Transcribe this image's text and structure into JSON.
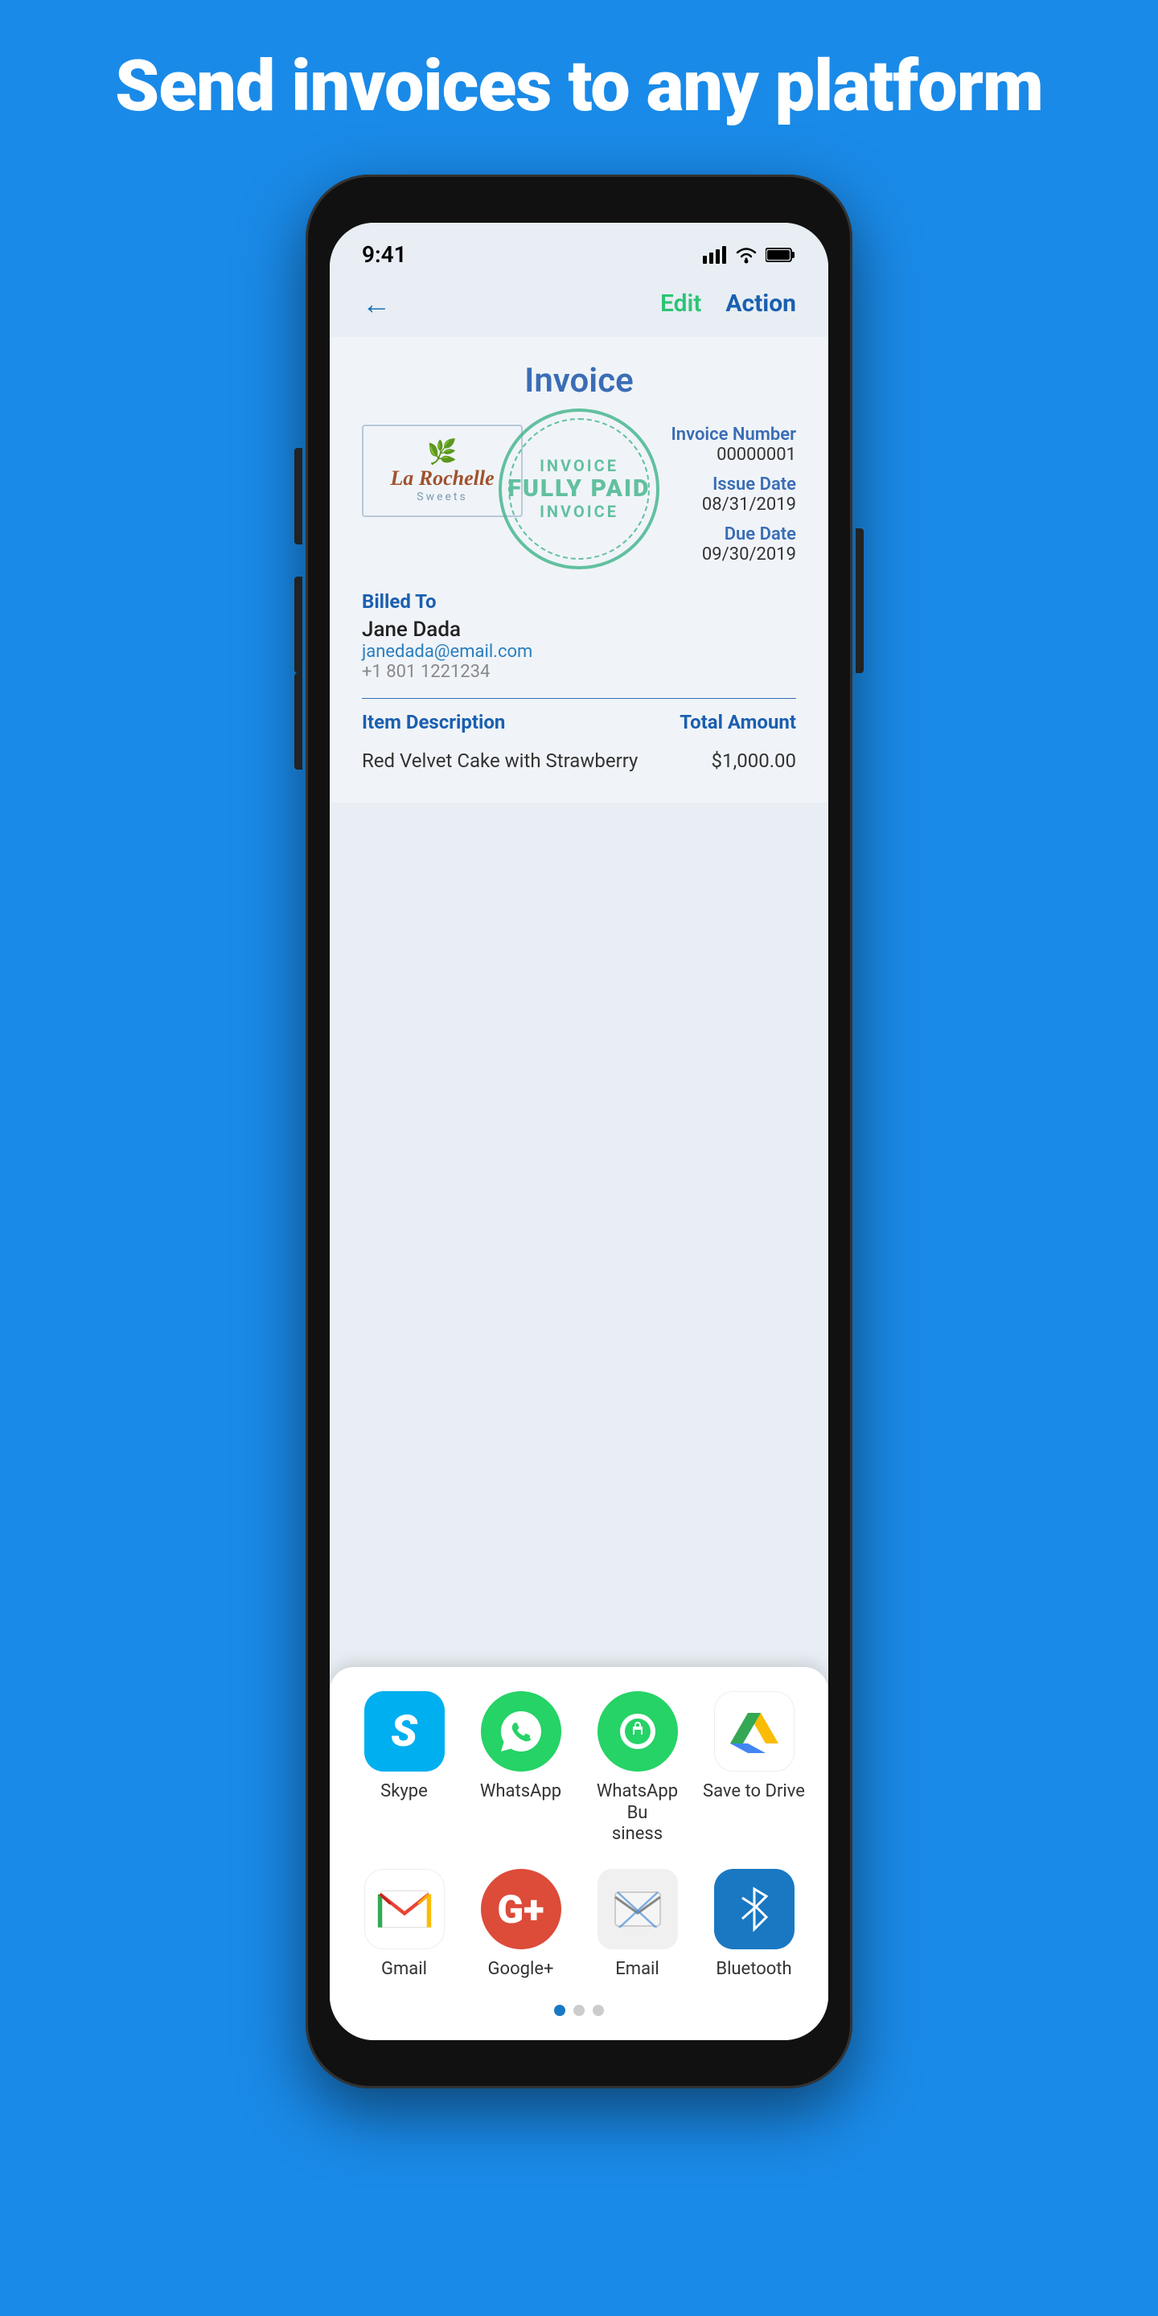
{
  "hero": {
    "title": "Send invoices to any platform"
  },
  "statusBar": {
    "time": "9:41",
    "signal": "▂▄▆",
    "wifi": "wifi",
    "battery": "battery"
  },
  "nav": {
    "backIcon": "←",
    "editLabel": "Edit",
    "actionLabel": "Action"
  },
  "invoice": {
    "title": "Invoice",
    "logoTitle": "La Rochelle",
    "logoSubtitle": "Sweets",
    "stampLine1": "INVOICE",
    "stampLine2": "FULLY PAID",
    "stampLine3": "INVOICE",
    "invoiceNumberLabel": "Invoice Number",
    "invoiceNumber": "00000001",
    "issueDateLabel": "Issue Date",
    "issueDate": "08/31/2019",
    "dueDateLabel": "Due Date",
    "dueDate": "09/30/2019",
    "billedToLabel": "Billed To",
    "clientName": "Jane Dada",
    "clientEmail": "janedada@email.com",
    "clientPhone": "+1 801 1221234",
    "itemDescLabel": "Item Description",
    "totalAmountLabel": "Total Amount",
    "items": [
      {
        "description": "Red Velvet Cake with Strawberry",
        "amount": "$1,000.00"
      }
    ]
  },
  "shareSheet": {
    "apps": [
      {
        "id": "skype",
        "label": "Skype",
        "iconClass": "skype"
      },
      {
        "id": "whatsapp",
        "label": "WhatsApp",
        "iconClass": "whatsapp"
      },
      {
        "id": "whatsapp-business",
        "label": "WhatsApp Business",
        "iconClass": "whatsapp-business"
      },
      {
        "id": "save-to-drive",
        "label": "Save to Drive",
        "iconClass": "drive"
      },
      {
        "id": "gmail",
        "label": "Gmail",
        "iconClass": "gmail"
      },
      {
        "id": "google-plus",
        "label": "Google+",
        "iconClass": "googleplus"
      },
      {
        "id": "email",
        "label": "Email",
        "iconClass": "email"
      },
      {
        "id": "bluetooth",
        "label": "Bluetooth",
        "iconClass": "bluetooth"
      }
    ],
    "dots": [
      {
        "active": true
      },
      {
        "active": false
      },
      {
        "active": false
      }
    ]
  }
}
